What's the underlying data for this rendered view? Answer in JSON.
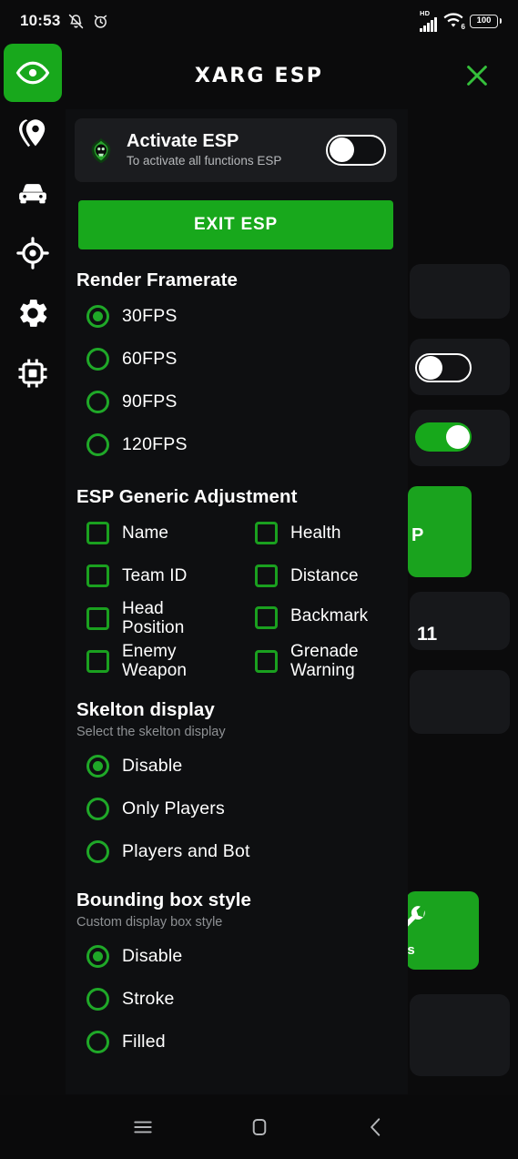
{
  "status_bar": {
    "time": "10:53",
    "icons_left": [
      "bell-muted-icon",
      "alarm-clock-icon"
    ],
    "network_label": "HD",
    "wifi_label": "6",
    "battery_level": "100"
  },
  "header": {
    "title": "XARG ESP",
    "close_label": "×",
    "close_color": "#35c03b"
  },
  "sidebar": {
    "items": [
      {
        "name": "eye-icon",
        "label": "ESP",
        "active": true
      },
      {
        "name": "pin-icon",
        "label": "Location",
        "active": false
      },
      {
        "name": "car-icon",
        "label": "Vehicle",
        "active": false
      },
      {
        "name": "aim-icon",
        "label": "Aimbot",
        "active": false
      },
      {
        "name": "gear-icon",
        "label": "Settings",
        "active": false
      },
      {
        "name": "chip-icon",
        "label": "Memory",
        "active": false
      }
    ]
  },
  "panel": {
    "activate_card": {
      "icon": "xarg-emblem-icon",
      "title": "Activate ESP",
      "subtitle": "To activate all functions ESP",
      "toggle_on": false
    },
    "exit_button_label": "EXIT ESP",
    "render_framerate": {
      "title": "Render Framerate",
      "options": [
        {
          "label": "30FPS",
          "selected": true
        },
        {
          "label": "60FPS",
          "selected": false
        },
        {
          "label": "90FPS",
          "selected": false
        },
        {
          "label": "120FPS",
          "selected": false
        }
      ]
    },
    "esp_generic_adjustment": {
      "title": "ESP Generic Adjustment",
      "options": [
        {
          "label": "Name",
          "checked": false
        },
        {
          "label": "Health",
          "checked": false
        },
        {
          "label": "Team ID",
          "checked": false
        },
        {
          "label": "Distance",
          "checked": false
        },
        {
          "label": "Head Position",
          "checked": false
        },
        {
          "label": "Backmark",
          "checked": false
        },
        {
          "label": "Enemy Weapon",
          "checked": false
        },
        {
          "label": "Grenade Warning",
          "checked": false
        }
      ]
    },
    "skelton_display": {
      "title": "Skelton display",
      "subtitle": "Select the skelton display",
      "options": [
        {
          "label": "Disable",
          "selected": true
        },
        {
          "label": "Only Players",
          "selected": false
        },
        {
          "label": "Players and Bot",
          "selected": false
        }
      ]
    },
    "bounding_box_style": {
      "title": "Bounding box style",
      "subtitle": "Custom display box style",
      "options": [
        {
          "label": "Disable",
          "selected": true
        },
        {
          "label": "Stroke",
          "selected": false
        },
        {
          "label": "Filled",
          "selected": false
        }
      ]
    }
  },
  "background": {
    "partial_button_label": "P",
    "partial_text": "11",
    "partial_tools_label": "ols",
    "toggle_off_state": "off",
    "toggle_on_state": "on"
  },
  "bottom_nav": {
    "items": [
      {
        "name": "menu-icon",
        "label": "Recents"
      },
      {
        "name": "home-icon",
        "label": "Home"
      },
      {
        "name": "back-icon",
        "label": "Back"
      }
    ]
  },
  "colors": {
    "accent_green": "#18a81c",
    "ring_green": "#1fa828",
    "panel_bg": "#0e0f11",
    "card_bg": "#1b1c1f",
    "screen_bg": "#0b0b0c"
  }
}
